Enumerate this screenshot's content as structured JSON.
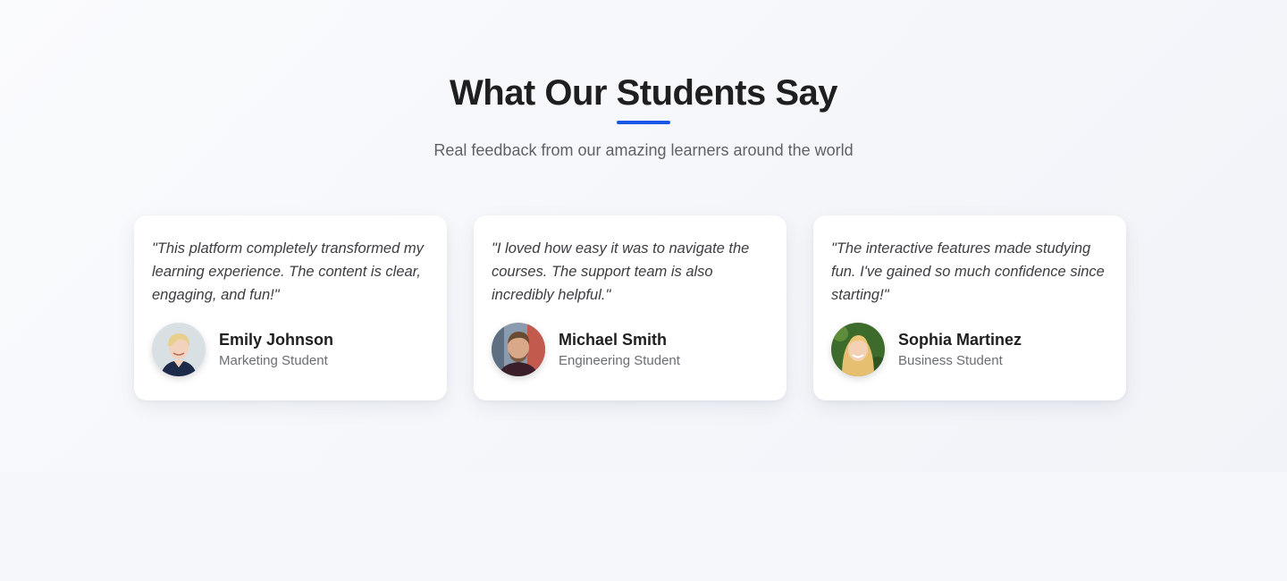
{
  "heading": {
    "title": "What Our Students Say",
    "subtitle": "Real feedback from our amazing learners around the world",
    "accent_color": "#1a56e8"
  },
  "testimonials": [
    {
      "quote": "\"This platform completely transformed my learning experience. The content is clear, engaging, and fun!\"",
      "name": "Emily Johnson",
      "role": "Marketing Student",
      "avatar": "emily-avatar"
    },
    {
      "quote": "\"I loved how easy it was to navigate the courses. The support team is also incredibly helpful.\"",
      "name": "Michael Smith",
      "role": "Engineering Student",
      "avatar": "michael-avatar"
    },
    {
      "quote": "\"The interactive features made studying fun. I've gained so much confidence since starting!\"",
      "name": "Sophia Martinez",
      "role": "Business Student",
      "avatar": "sophia-avatar"
    }
  ]
}
